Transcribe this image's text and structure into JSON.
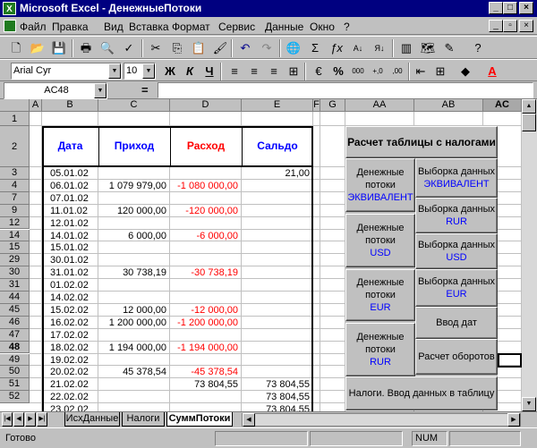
{
  "window": {
    "title": "Microsoft Excel - ДенежныеПотоки",
    "app_icon": "excel-icon"
  },
  "menu": [
    "Файл",
    "Правка",
    "Вид",
    "Вставка",
    "Формат",
    "Сервис",
    "Данные",
    "Окно",
    "?"
  ],
  "menu_mnemonic": [
    "Ф",
    "П",
    "В",
    "т",
    "о",
    "С",
    "Д",
    "О",
    "?"
  ],
  "font_combo": {
    "value": "Arial Cyr"
  },
  "size_combo": {
    "value": "10"
  },
  "format_buttons": {
    "bold": "Ж",
    "italic": "К",
    "underline": "Ч",
    "percent": "%",
    "comma": "000",
    "inc_dec": "+,0",
    "dec_dec": ",00"
  },
  "name_box": {
    "value": "AC48"
  },
  "formula": {
    "equals": "="
  },
  "columns": [
    "A",
    "B",
    "C",
    "D",
    "E",
    "F",
    "G",
    "AA",
    "AB",
    "AC"
  ],
  "rows": [
    "1",
    "2",
    "3",
    "4",
    "7",
    "9",
    "12",
    "14",
    "15",
    "29",
    "30",
    "31",
    "44",
    "45",
    "46",
    "47",
    "48",
    "49",
    "50",
    "51",
    "52"
  ],
  "table_headers": {
    "date": "Дата",
    "income": "Приход",
    "expense": "Расход",
    "balance": "Сальдо"
  },
  "table_rows": [
    {
      "date": "05.01.02",
      "income": "",
      "expense": "",
      "balance": "21,00"
    },
    {
      "date": "06.01.02",
      "income": "1 079 979,00",
      "expense": "-1 080 000,00",
      "balance": ""
    },
    {
      "date": "07.01.02",
      "income": "",
      "expense": "",
      "balance": ""
    },
    {
      "date": "11.01.02",
      "income": "120 000,00",
      "expense": "-120 000,00",
      "balance": ""
    },
    {
      "date": "12.01.02",
      "income": "",
      "expense": "",
      "balance": ""
    },
    {
      "date": "14.01.02",
      "income": "6 000,00",
      "expense": "-6 000,00",
      "balance": ""
    },
    {
      "date": "15.01.02",
      "income": "",
      "expense": "",
      "balance": ""
    },
    {
      "date": "30.01.02",
      "income": "",
      "expense": "",
      "balance": ""
    },
    {
      "date": "31.01.02",
      "income": "30 738,19",
      "expense": "-30 738,19",
      "balance": ""
    },
    {
      "date": "01.02.02",
      "income": "",
      "expense": "",
      "balance": ""
    },
    {
      "date": "14.02.02",
      "income": "",
      "expense": "",
      "balance": ""
    },
    {
      "date": "15.02.02",
      "income": "12 000,00",
      "expense": "-12 000,00",
      "balance": ""
    },
    {
      "date": "16.02.02",
      "income": "1 200 000,00",
      "expense": "-1 200 000,00",
      "balance": ""
    },
    {
      "date": "17.02.02",
      "income": "",
      "expense": "",
      "balance": ""
    },
    {
      "date": "18.02.02",
      "income": "1 194 000,00",
      "expense": "-1 194 000,00",
      "balance": ""
    },
    {
      "date": "19.02.02",
      "income": "",
      "expense": "",
      "balance": ""
    },
    {
      "date": "20.02.02",
      "income": "45 378,54",
      "expense": "-45 378,54",
      "balance": ""
    },
    {
      "date": "21.02.02",
      "income": "",
      "expense": "73 804,55",
      "balance": "73 804,55"
    },
    {
      "date": "22.02.02",
      "income": "",
      "expense": "",
      "balance": "73 804,55"
    },
    {
      "date": "23.02.02",
      "income": "",
      "expense": "",
      "balance": "73 804,55"
    }
  ],
  "panel": {
    "title": "Расчет таблицы с налогами",
    "left_buttons": [
      {
        "line1": "Денежные",
        "line2": "потоки",
        "line3": "ЭКВИВАЛЕНТ"
      },
      {
        "line1": "Денежные",
        "line2": "потоки",
        "line3": "USD"
      },
      {
        "line1": "Денежные",
        "line2": "потоки",
        "line3": "EUR"
      },
      {
        "line1": "Денежные",
        "line2": "потоки",
        "line3": "RUR"
      }
    ],
    "right_buttons": [
      {
        "line1": "Выборка данных",
        "line2": "ЭКВИВАЛЕНТ"
      },
      {
        "line1": "Выборка данных",
        "line2": "RUR"
      },
      {
        "line1": "Выборка данных",
        "line2": "USD"
      },
      {
        "line1": "Выборка данных",
        "line2": "EUR"
      }
    ],
    "enter_dates": "Ввод дат",
    "turnover": "Расчет оборотов",
    "taxes": "Налоги. Ввод данных в таблицу"
  },
  "sheets": [
    "ИсхДанные",
    "Налоги",
    "СуммПотоки"
  ],
  "active_sheet": "СуммПотоки",
  "status": {
    "ready": "Готово",
    "num": "NUM"
  },
  "colors": {
    "title_bar": "#000080",
    "header_text": "#0000ff",
    "negative": "#ff0000"
  }
}
